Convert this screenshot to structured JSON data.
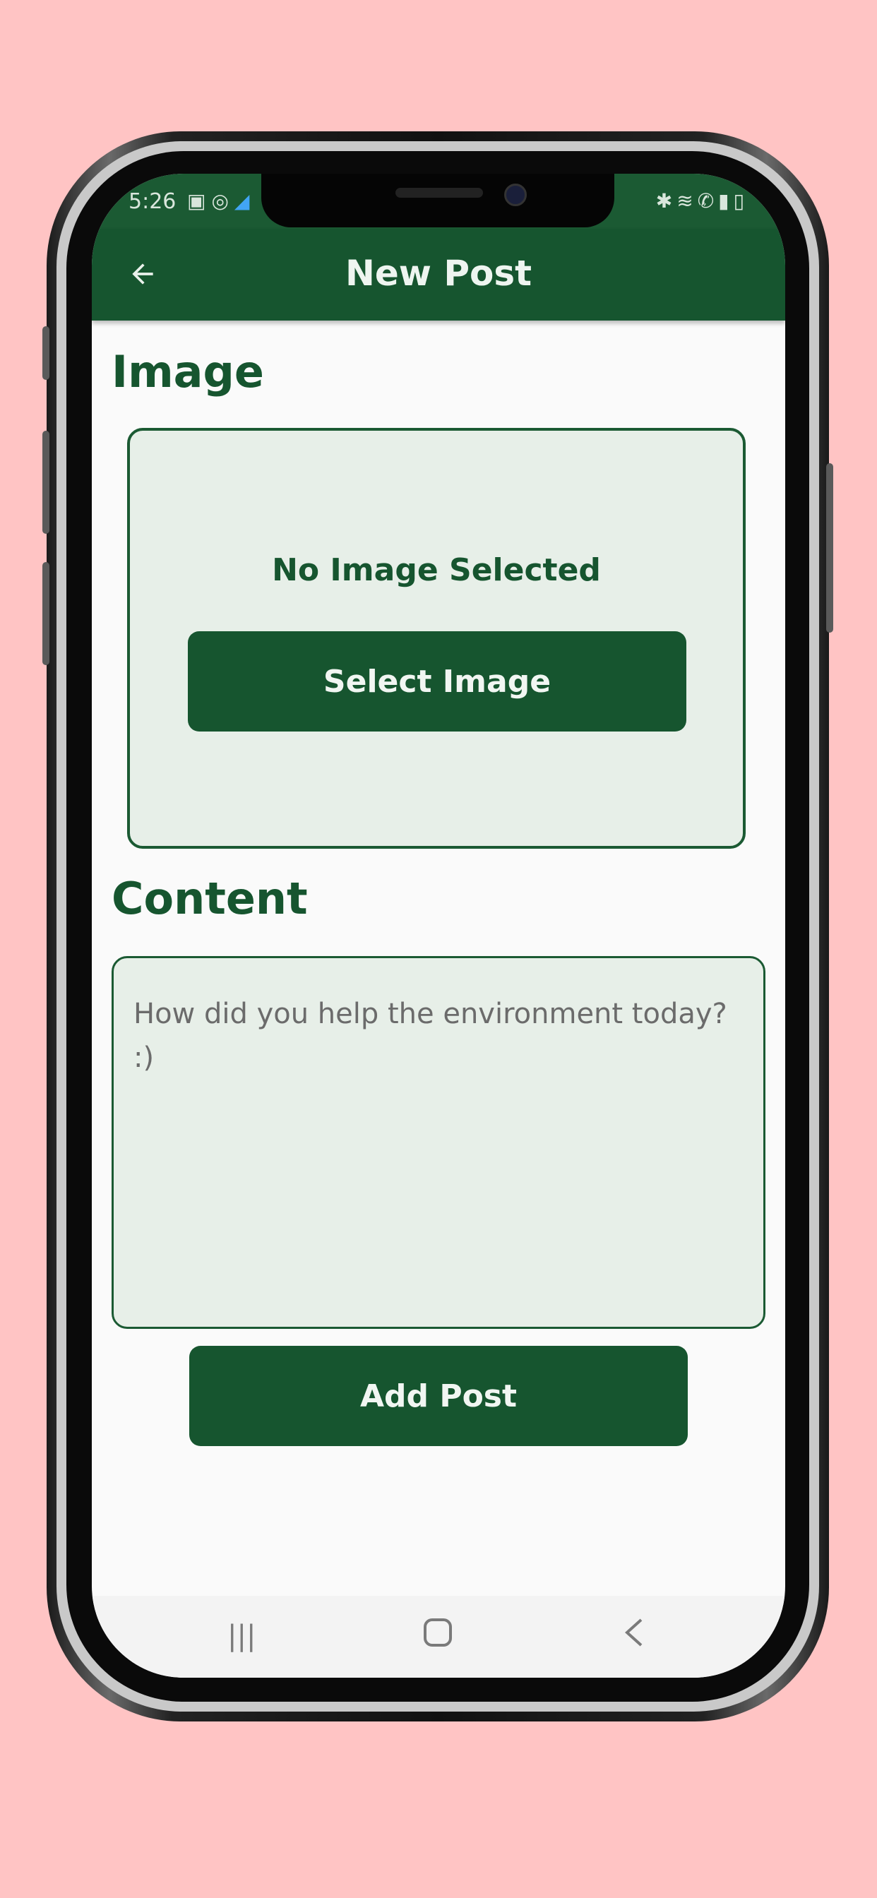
{
  "status_bar": {
    "time": "5:26",
    "left_icons": [
      "image-icon",
      "circle-icon",
      "flutter-icon"
    ],
    "right_icons": [
      "bluetooth-icon",
      "wifi-icon",
      "call-icon",
      "signal-icon",
      "battery-icon"
    ]
  },
  "app_bar": {
    "title": "New Post",
    "back_icon": "arrow-left-icon"
  },
  "image_section": {
    "label": "Image",
    "empty_text": "No Image Selected",
    "select_button_label": "Select Image"
  },
  "content_section": {
    "label": "Content",
    "placeholder": "How did you help the environment today? :)",
    "value": ""
  },
  "actions": {
    "add_post_label": "Add Post"
  },
  "nav_bar": {
    "icons": [
      "recent-apps-icon",
      "home-icon",
      "back-icon"
    ]
  },
  "colors": {
    "primary": "#16552f",
    "field_background": "#e7efe8",
    "page_background": "#ffc4c4"
  }
}
